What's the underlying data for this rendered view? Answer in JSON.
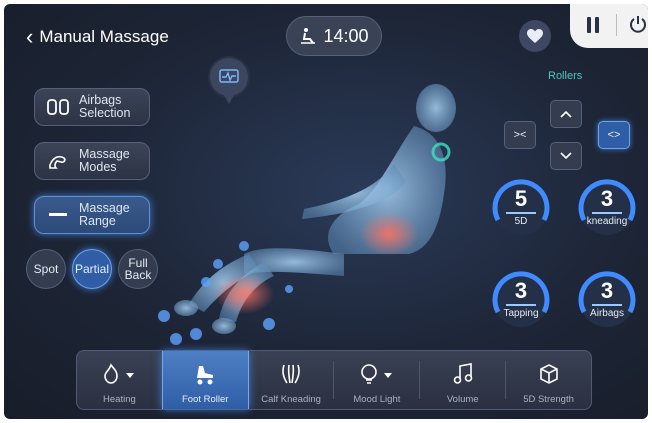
{
  "header": {
    "title": "Manual Massage",
    "timer": "14:00"
  },
  "left": {
    "airbags": "Airbags Selection",
    "airbags_l1": "Airbags",
    "airbags_l2": "Selection",
    "modes_l1": "Massage",
    "modes_l2": "Modes",
    "range_l1": "Massage",
    "range_l2": "Range",
    "pills": [
      "Spot",
      "Partial",
      "Full Back"
    ],
    "full_l1": "Full",
    "full_l2": "Back"
  },
  "rollers": {
    "label": "Rollers",
    "inward": "><",
    "outward": "<>"
  },
  "gauges": [
    {
      "value": "5",
      "label": "5D"
    },
    {
      "value": "3",
      "label": "kneading"
    },
    {
      "value": "3",
      "label": "Tapping"
    },
    {
      "value": "3",
      "label": "Airbags"
    }
  ],
  "bottom": {
    "items": [
      "Heating",
      "Foot Roller",
      "Calf Kneading",
      "Mood Light",
      "Volume",
      "5D Strength"
    ]
  },
  "colors": {
    "accent": "#2f5ea6",
    "teal": "#4fc7c2",
    "background": "#1d2536"
  }
}
